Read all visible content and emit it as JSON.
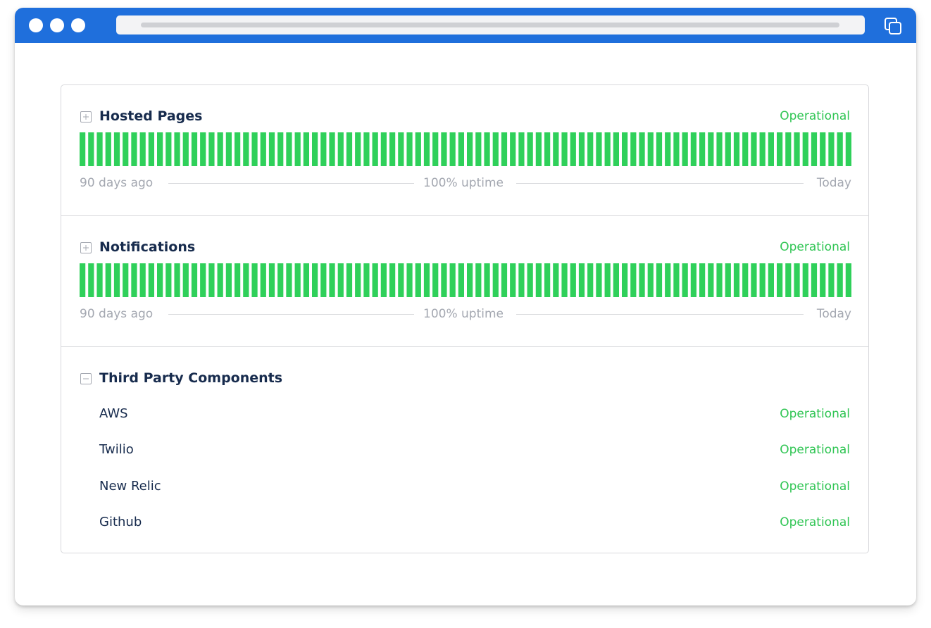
{
  "window": {
    "controls": [
      "window-dot",
      "window-dot",
      "window-dot"
    ],
    "copy_icon": "copy-window-icon"
  },
  "components": [
    {
      "name": "Hosted Pages",
      "status": "Operational",
      "toggle_icon": "expand-plus-icon",
      "uptime_days": 90,
      "uptime_fraction": 1.0,
      "legend": {
        "start": "90 days ago",
        "middle": "100% uptime",
        "end": "Today"
      }
    },
    {
      "name": "Notifications",
      "status": "Operational",
      "toggle_icon": "expand-plus-icon",
      "uptime_days": 90,
      "uptime_fraction": 1.0,
      "legend": {
        "start": "90 days ago",
        "middle": "100% uptime",
        "end": "Today"
      }
    }
  ],
  "third_party": {
    "name": "Third Party Components",
    "toggle_icon": "collapse-minus-icon",
    "items": [
      {
        "name": "AWS",
        "status": "Operational"
      },
      {
        "name": "Twilio",
        "status": "Operational"
      },
      {
        "name": "New Relic",
        "status": "Operational"
      },
      {
        "name": "Github",
        "status": "Operational"
      }
    ]
  },
  "colors": {
    "titlebar": "#1f6fdc",
    "operational": "#2fc553",
    "bar": "#2fd05a",
    "title_text": "#172b4d",
    "muted_text": "#a4a8b1"
  }
}
